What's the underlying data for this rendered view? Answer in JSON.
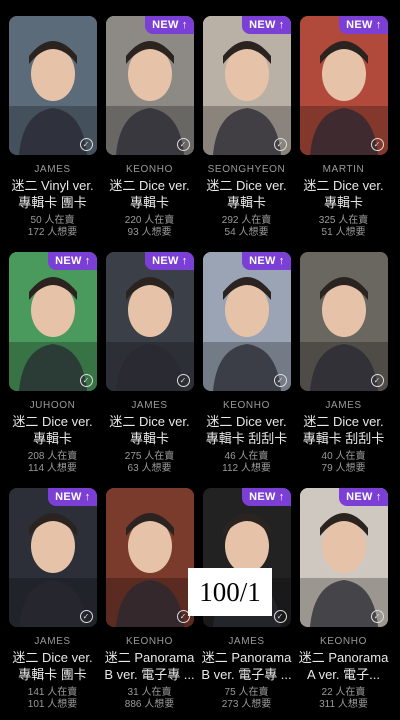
{
  "badge": {
    "label": "NEW",
    "arrow": "↑"
  },
  "overlay_text": "100/1",
  "cards": [
    {
      "artist": "JAMES",
      "line1": "迷二 Vinyl ver.",
      "line2": "專輯卡 團卡",
      "selling": "50 人在賣",
      "wanted": "172 人想要",
      "is_new": false,
      "bg": "#5b6b7a"
    },
    {
      "artist": "KEONHO",
      "line1": "迷二 Dice ver.",
      "line2": "專輯卡",
      "selling": "220 人在賣",
      "wanted": "93 人想要",
      "is_new": true,
      "bg": "#8d8a86"
    },
    {
      "artist": "SEONGHYEON",
      "line1": "迷二 Dice ver.",
      "line2": "專輯卡",
      "selling": "292 人在賣",
      "wanted": "54 人想要",
      "is_new": true,
      "bg": "#b9b1a6"
    },
    {
      "artist": "MARTIN",
      "line1": "迷二 Dice ver.",
      "line2": "專輯卡",
      "selling": "325 人在賣",
      "wanted": "51 人想要",
      "is_new": true,
      "bg": "#b14a3a"
    },
    {
      "artist": "JUHOON",
      "line1": "迷二 Dice ver.",
      "line2": "專輯卡",
      "selling": "208 人在賣",
      "wanted": "114 人想要",
      "is_new": true,
      "bg": "#4a9a5d"
    },
    {
      "artist": "JAMES",
      "line1": "迷二 Dice ver.",
      "line2": "專輯卡",
      "selling": "275 人在賣",
      "wanted": "63 人想要",
      "is_new": true,
      "bg": "#3b4048"
    },
    {
      "artist": "KEONHO",
      "line1": "迷二 Dice ver.",
      "line2": "專輯卡 刮刮卡",
      "selling": "46 人在賣",
      "wanted": "112 人想要",
      "is_new": true,
      "bg": "#9aa4b5"
    },
    {
      "artist": "JAMES",
      "line1": "迷二 Dice ver.",
      "line2": "專輯卡 刮刮卡",
      "selling": "40 人在賣",
      "wanted": "79 人想要",
      "is_new": false,
      "bg": "#6a6660"
    },
    {
      "artist": "JAMES",
      "line1": "迷二 Dice ver.",
      "line2": "專輯卡 團卡",
      "selling": "141 人在賣",
      "wanted": "101 人想要",
      "is_new": true,
      "bg": "#2c2f38"
    },
    {
      "artist": "KEONHO",
      "line1": "迷二 Panorama",
      "line2": "B ver. 電子專 ...",
      "selling": "31 人在賣",
      "wanted": "886 人想要",
      "is_new": false,
      "bg": "#7a3a2c"
    },
    {
      "artist": "JAMES",
      "line1": "迷二 Panorama",
      "line2": "B ver. 電子專 ...",
      "selling": "75 人在賣",
      "wanted": "273 人想要",
      "is_new": true,
      "bg": "#222222"
    },
    {
      "artist": "KEONHO",
      "line1": "迷二 Panorama",
      "line2": "A ver. 電子...",
      "selling": "22 人在賣",
      "wanted": "311 人想要",
      "is_new": true,
      "bg": "#cfc8c0"
    }
  ]
}
